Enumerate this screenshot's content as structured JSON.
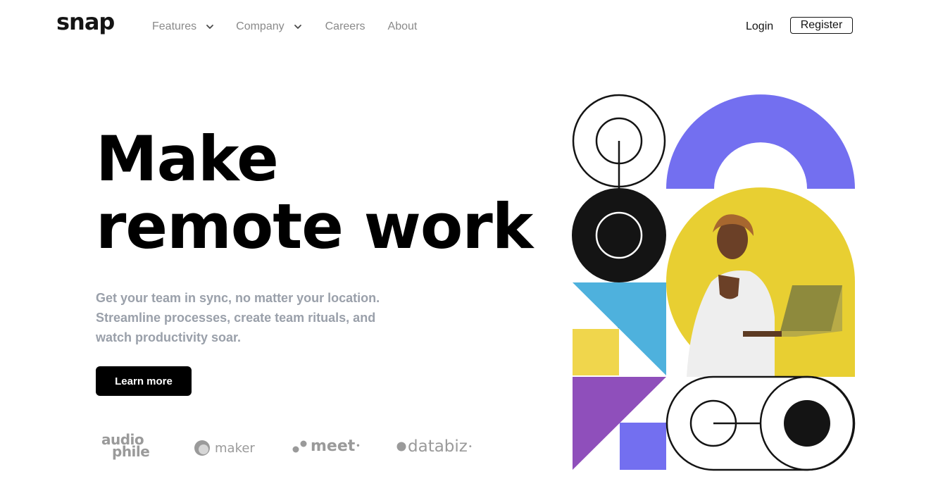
{
  "header": {
    "logo": "snap",
    "nav": [
      {
        "label": "Features",
        "has_dropdown": true
      },
      {
        "label": "Company",
        "has_dropdown": true
      },
      {
        "label": "Careers",
        "has_dropdown": false
      },
      {
        "label": "About",
        "has_dropdown": false
      }
    ],
    "login_label": "Login",
    "register_label": "Register"
  },
  "hero": {
    "headline_line1": "Make",
    "headline_line2": "remote work",
    "subtext": "Get your team in sync, no matter your location. Streamline processes, create team rituals, and watch productivity soar.",
    "cta_label": "Learn more"
  },
  "clients": {
    "audiophile_line1": "audio",
    "audiophile_line2": "phile",
    "maker": "maker",
    "meet": "meet",
    "databiz": "databiz"
  },
  "colors": {
    "purple": "#736ff0",
    "yellow": "#e8cf32",
    "blue": "#4eb1dd",
    "violet": "#8f4fbb",
    "light_yellow": "#f0d64c",
    "ink": "#141414",
    "muted_text": "#9aa0aa"
  },
  "icons": [
    "chevron-down-icon",
    "maker-logo-icon",
    "meet-logo-icon",
    "databiz-logo-icon"
  ]
}
